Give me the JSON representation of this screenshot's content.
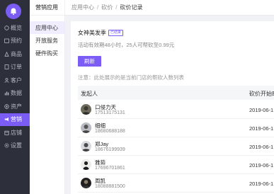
{
  "sidebar": {
    "items": [
      {
        "label": "概览",
        "icon": "overview-icon",
        "active": false
      },
      {
        "label": "预约",
        "icon": "calendar-icon",
        "active": false
      },
      {
        "label": "商品",
        "icon": "goods-icon",
        "active": false
      },
      {
        "label": "订单",
        "icon": "order-icon",
        "active": false
      },
      {
        "label": "客户",
        "icon": "customer-icon",
        "active": false
      },
      {
        "label": "数据",
        "icon": "data-chart-icon",
        "active": false
      },
      {
        "label": "资产",
        "icon": "asset-icon",
        "active": false
      },
      {
        "label": "营销",
        "icon": "marketing-icon",
        "active": true
      },
      {
        "label": "店铺",
        "icon": "store-icon",
        "active": false
      },
      {
        "label": "设置",
        "icon": "settings-icon",
        "active": false
      }
    ]
  },
  "submenu": {
    "title": "营销应用",
    "items": [
      {
        "label": "应用中心",
        "active": true
      },
      {
        "label": "开放服务",
        "active": false
      },
      {
        "label": "硬件购买",
        "active": false
      }
    ]
  },
  "breadcrumb": {
    "items": [
      "应用中心",
      "砍价"
    ],
    "current": "砍价记录"
  },
  "activity": {
    "title": "女神美发季",
    "badge": "已结束",
    "description": "活动有效期48小时，25人可帮砍至0.99元"
  },
  "refresh_label": "刷新",
  "notice": "注意：此处展示的是当前门店的帮砍人数列表",
  "table": {
    "headers": {
      "initiator": "发起人",
      "start_time": "砍价开始时"
    },
    "rows": [
      {
        "name": "口侵力天",
        "phone": "17513175131",
        "time": "2019-06-1"
      },
      {
        "name": "细细",
        "phone": "18680688188",
        "time": "2019-06-1"
      },
      {
        "name": "郑Jay",
        "phone": "18676199939",
        "time": "2019-06-1"
      },
      {
        "name": "雅茹",
        "phone": "17696701861",
        "time": "2019-06-1"
      },
      {
        "name": "周凯",
        "phone": "18088881500",
        "time": "2019-06-1"
      }
    ]
  },
  "colors": {
    "accent": "#7b5cf5",
    "sidebar_bg": "#2d2f3b"
  }
}
